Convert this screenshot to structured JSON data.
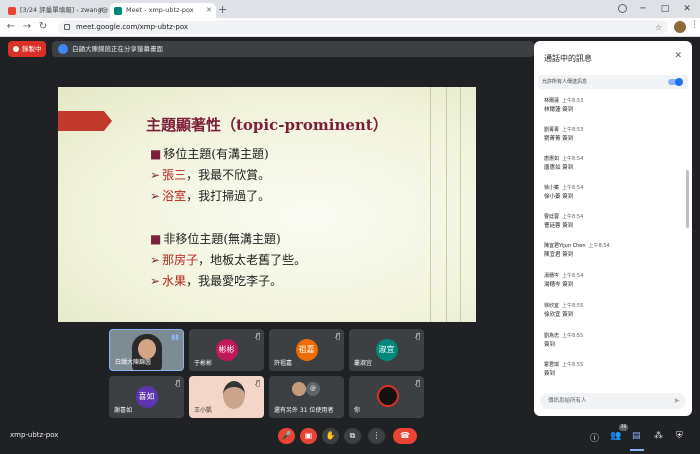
{
  "browser": {
    "tabs": [
      {
        "title": "[3/24 評量單填報] - zwang@g...",
        "favicon_color": "#ea4335"
      },
      {
        "title": "Meet - xmp-ubtz-pox",
        "favicon_color": "#00897b"
      }
    ],
    "new_tab": "+",
    "url": "meet.google.com/xmp-ubtz-pox",
    "controls": {
      "minimize": "─",
      "maximize": "□",
      "close": "✕"
    }
  },
  "meet": {
    "recording_label": "錄製中",
    "presenting_banner": "白韻大陳錦茵正在分享螢幕畫面",
    "meeting_code": "xmp-ubtz-pox",
    "participant_count": "39"
  },
  "slide": {
    "title": "主題顯著性（topic-prominent）",
    "lines": [
      {
        "marker": "■",
        "pre": "移位主題(有溝主題)",
        "hl": "",
        "post": ""
      },
      {
        "marker": "➢",
        "pre": "",
        "hl": "張三",
        "post": "，我最不欣賞。"
      },
      {
        "marker": "➢",
        "pre": "",
        "hl": "浴室",
        "post": "，我打掃過了。"
      },
      {
        "marker": "■",
        "pre": "非移位主題(無溝主題)",
        "hl": "",
        "post": ""
      },
      {
        "marker": "➢",
        "pre": "",
        "hl": "那房子",
        "post": "，地板太老舊了些。"
      },
      {
        "marker": "➢",
        "pre": "",
        "hl": "水果",
        "post": "，我最愛吃李子。"
      }
    ]
  },
  "tiles": [
    {
      "name": "白韻大陳錦茵",
      "avatar": ""
    },
    {
      "name": "于彬彬",
      "avatar": "彬彬",
      "color": "#c2185b"
    },
    {
      "name": "許祖嘉",
      "avatar": "祖嘉",
      "color": "#ef6c00"
    },
    {
      "name": "叢淑宜",
      "avatar": "淑宜",
      "color": "#00897b"
    },
    {
      "name": "謝喜如",
      "avatar": "喜如",
      "color": "#5e35b1"
    },
    {
      "name": "王小凱",
      "avatar": ""
    },
    {
      "name": "還有另外 31 位使用者",
      "avatar": "",
      "count": "31"
    },
    {
      "name": "你",
      "avatar": ""
    }
  ],
  "chat": {
    "title": "通話中的訊息",
    "allow_label": "允許所有人傳送訊息",
    "messages": [
      {
        "sender": "林爾蓮",
        "time": "上午8:53",
        "text": "林爾蓮 簽到"
      },
      {
        "sender": "劉菁菁",
        "time": "上午8:53",
        "text": "劉菁菁 簽到"
      },
      {
        "sender": "唐惠如",
        "time": "上午8:54",
        "text": "唐惠如 簽到"
      },
      {
        "sender": "徐小蓁",
        "time": "上午8:54",
        "text": "徐小蓁 簽到"
      },
      {
        "sender": "曹廷蓉",
        "time": "上午8:54",
        "text": "曹廷蓉 簽到"
      },
      {
        "sender": "陳宜君Yijun Chen",
        "time": "上午8:54",
        "text": "陳宜君 簽到"
      },
      {
        "sender": "湯穗岑",
        "time": "上午8:54",
        "text": "湯穗岑 簽到"
      },
      {
        "sender": "徐欣宜",
        "time": "上午8:55",
        "text": "徐欣宜 簽到"
      },
      {
        "sender": "劉為忠",
        "time": "上午8:55",
        "text": "簽到"
      },
      {
        "sender": "霍君琪",
        "time": "上午8:55",
        "text": "簽到"
      }
    ],
    "input_placeholder": "傳訊息給所有人"
  }
}
